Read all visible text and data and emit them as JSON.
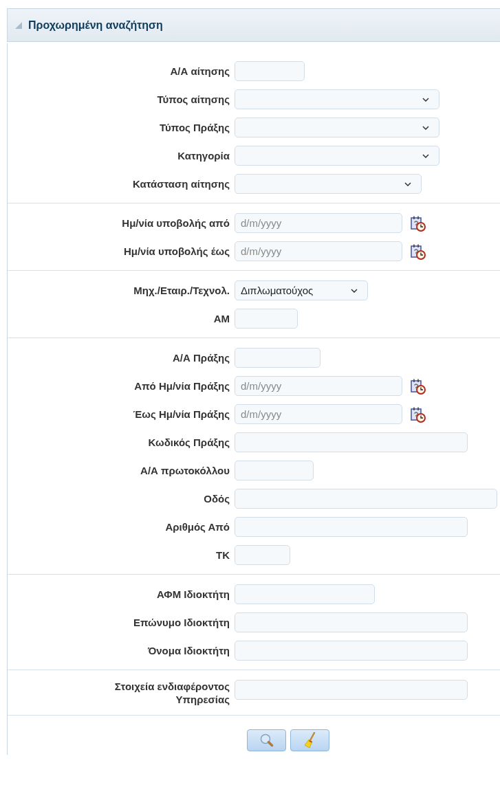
{
  "panel": {
    "title": "Προχωρημένη αναζήτηση",
    "expanded": true
  },
  "groups": [
    {
      "fields": [
        {
          "label": "Α/Α αίτησης",
          "kind": "text"
        },
        {
          "label": "Τύπος αίτησης",
          "kind": "select"
        },
        {
          "label": "Τύπος Πράξης",
          "kind": "select"
        },
        {
          "label": "Κατηγορία",
          "kind": "select"
        },
        {
          "label": "Κατάσταση αίτησης",
          "kind": "select"
        }
      ]
    },
    {
      "fields": [
        {
          "label": "Ημ/νία υποβολής από",
          "kind": "date",
          "placeholder": "d/m/yyyy"
        },
        {
          "label": "Ημ/νία υποβολής έως",
          "kind": "date",
          "placeholder": "d/m/yyyy"
        }
      ]
    },
    {
      "fields": [
        {
          "label": "Μηχ./Εταιρ./Τεχνολ.",
          "kind": "select",
          "value": "Διπλωματούχος"
        },
        {
          "label": "ΑΜ",
          "kind": "text"
        }
      ]
    },
    {
      "fields": [
        {
          "label": "Α/Α Πράξης",
          "kind": "text"
        },
        {
          "label": "Από Ημ/νία Πράξης",
          "kind": "date",
          "placeholder": "d/m/yyyy"
        },
        {
          "label": "Έως Ημ/νία Πράξης",
          "kind": "date",
          "placeholder": "d/m/yyyy"
        },
        {
          "label": "Κωδικός Πράξης",
          "kind": "text"
        },
        {
          "label": "Α/Α πρωτοκόλλου",
          "kind": "text"
        },
        {
          "label": "Οδός",
          "kind": "text"
        },
        {
          "label": "Αριθμός Από",
          "kind": "text"
        },
        {
          "label": "ΤΚ",
          "kind": "text"
        }
      ]
    },
    {
      "fields": [
        {
          "label": "ΑΦΜ Ιδιοκτήτη",
          "kind": "text"
        },
        {
          "label": "Επώνυμο Ιδιοκτήτη",
          "kind": "text"
        },
        {
          "label": "Όνομα Ιδιοκτήτη",
          "kind": "text"
        }
      ]
    },
    {
      "fields": [
        {
          "label": "Στοιχεία ενδιαφέροντος Υπηρεσίας",
          "kind": "text"
        }
      ]
    }
  ],
  "buttons": [
    {
      "kind": "search"
    },
    {
      "kind": "clear"
    }
  ]
}
